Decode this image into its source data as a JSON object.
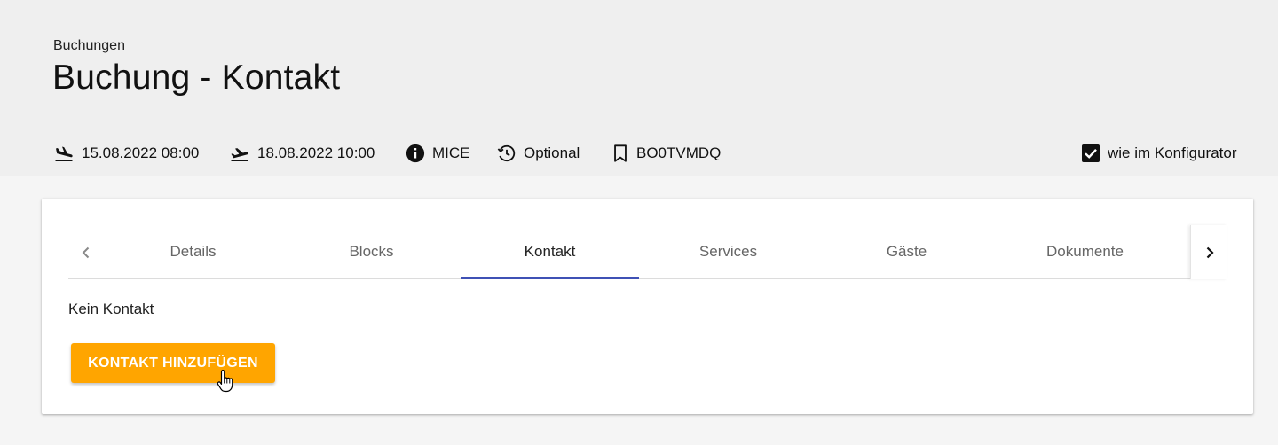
{
  "header": {
    "breadcrumb": "Buchungen",
    "title": "Buchung - Kontakt"
  },
  "meta": {
    "arrival": {
      "icon": "flight-land-icon",
      "value": "15.08.2022 08:00"
    },
    "departure": {
      "icon": "flight-takeoff-icon",
      "value": "18.08.2022 10:00"
    },
    "type": {
      "icon": "info-icon",
      "value": "MICE"
    },
    "status": {
      "icon": "history-icon",
      "value": "Optional"
    },
    "booking_code": {
      "icon": "bookmark-icon",
      "value": "BO0TVMDQ"
    },
    "configurator": {
      "icon": "checkbox-checked-icon",
      "label": "wie im Konfigurator",
      "checked": true
    }
  },
  "tabs": [
    {
      "label": "Details",
      "active": false
    },
    {
      "label": "Blocks",
      "active": false
    },
    {
      "label": "Kontakt",
      "active": true
    },
    {
      "label": "Services",
      "active": false
    },
    {
      "label": "Gäste",
      "active": false
    },
    {
      "label": "Dokumente",
      "active": false
    }
  ],
  "contact": {
    "empty_text": "Kein Kontakt",
    "add_button_label": "KONTAKT HINZUFÜGEN"
  },
  "colors": {
    "accent": "#ffa500",
    "tab_indicator": "#3f51b5",
    "header_bg": "#efefef"
  }
}
